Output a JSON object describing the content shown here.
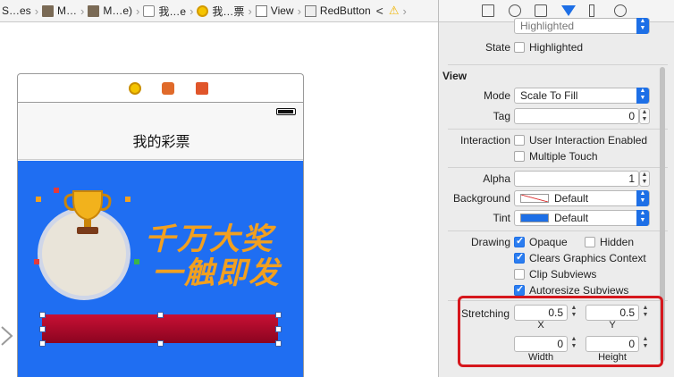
{
  "jumpbar": {
    "crumbs": [
      "S…es",
      "M…",
      "M…e)",
      "我…e",
      "我…票",
      "View",
      "RedButton"
    ],
    "back_glyph": "<",
    "warning_glyph": "⚠"
  },
  "canvas": {
    "nav_title": "我的彩票",
    "slogan_line1": "千万大奖",
    "slogan_line2": "一触即发"
  },
  "inspector": {
    "highlighted_label": "Highlighted",
    "state_label": "State",
    "state_value": "Highlighted",
    "section_view": "View",
    "mode_label": "Mode",
    "mode_value": "Scale To Fill",
    "tag_label": "Tag",
    "tag_value": "0",
    "interaction_label": "Interaction",
    "user_interaction": "User Interaction Enabled",
    "multiple_touch": "Multiple Touch",
    "alpha_label": "Alpha",
    "alpha_value": "1",
    "background_label": "Background",
    "background_value": "Default",
    "tint_label": "Tint",
    "tint_value": "Default",
    "drawing_label": "Drawing",
    "opaque": "Opaque",
    "hidden": "Hidden",
    "clears_graphics": "Clears Graphics Context",
    "clip_subviews": "Clip Subviews",
    "autoresize_subviews": "Autoresize Subviews",
    "stretching_label": "Stretching",
    "stretch_x": "0.5",
    "stretch_y": "0.5",
    "x_label": "X",
    "y_label": "Y",
    "stretch_width": "0",
    "stretch_height": "0",
    "width_label": "Width",
    "height_label": "Height"
  },
  "colors": {
    "accent": "#1d6fe6",
    "canvas_blue": "#1f6ef2",
    "button_red": "#b0102d",
    "slogan_orange": "#f2a01f",
    "highlight_red": "#d6171d"
  }
}
